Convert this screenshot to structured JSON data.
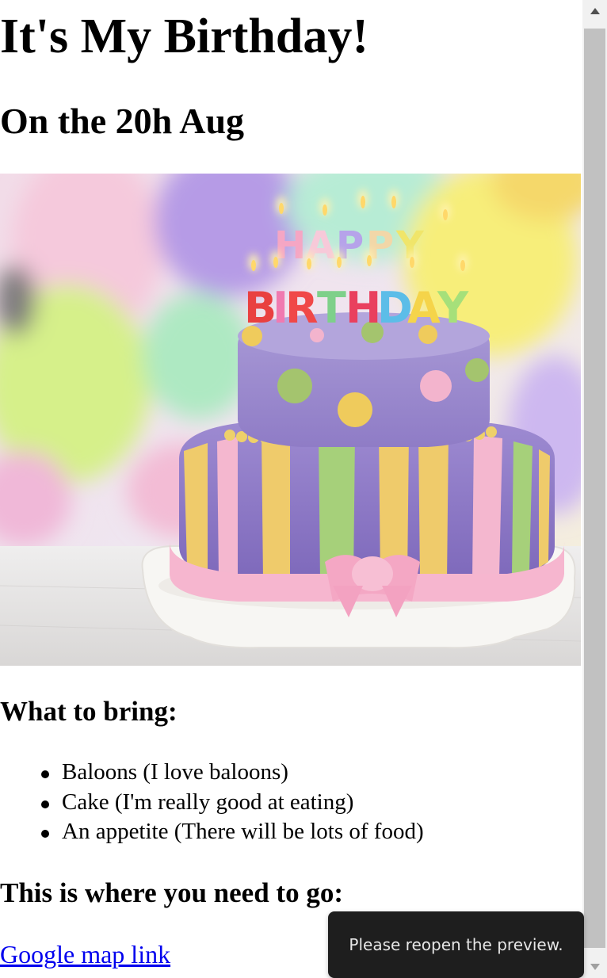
{
  "page": {
    "title": "It's My Birthday!",
    "subtitle": "On the 20h Aug"
  },
  "image": {
    "name": "birthday-cake-photo",
    "candle_text_line1": "HAPPY",
    "candle_text_line2": "BIRTHDAY"
  },
  "bring": {
    "heading": "What to bring:",
    "items": [
      "Baloons (I love baloons)",
      "Cake (I'm really good at eating)",
      "An appetite (There will be lots of food)"
    ]
  },
  "directions": {
    "heading": "This is where you need to go:",
    "link_text": "Google map link",
    "link_color": "#0000ee"
  },
  "toast": {
    "message": "Please reopen the preview."
  },
  "colors": {
    "toast_background": "#1e1e1e",
    "scrollbar_thumb": "#c1c1c1",
    "scrollbar_track": "#f1f1f1"
  }
}
